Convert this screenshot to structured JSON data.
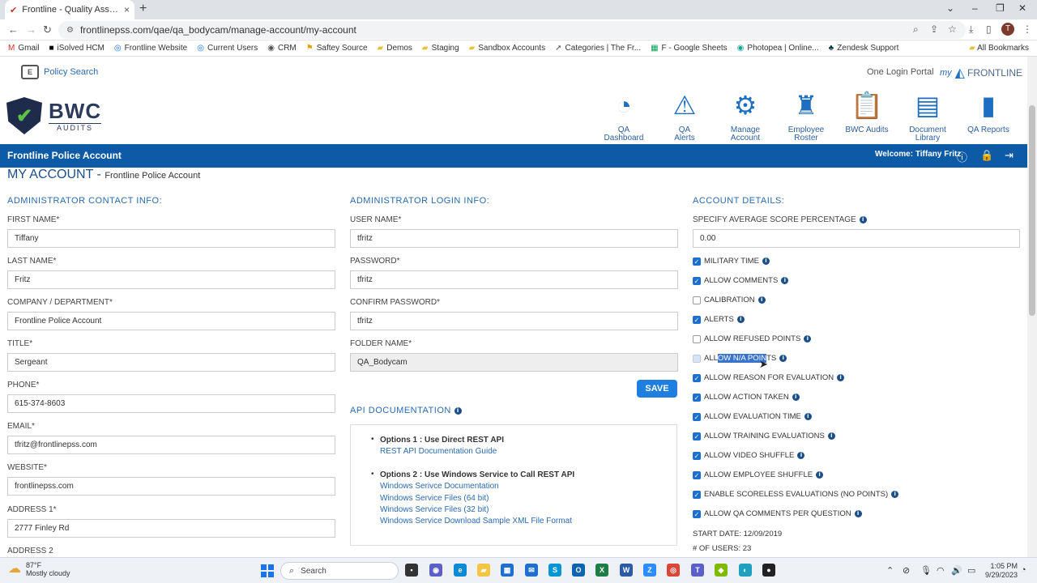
{
  "browser": {
    "tab_title": "Frontline - Quality Assurance E",
    "url": "frontlinepss.com/qae/qa_bodycam/manage-account/my-account",
    "avatar_letter": "T",
    "bookmarks": [
      "Gmail",
      "iSolved HCM",
      "Frontline Website",
      "Current Users",
      "CRM",
      "Saftey Source",
      "Demos",
      "Staging",
      "Sandbox Accounts",
      "Categories | The Fr...",
      "F - Google Sheets",
      "Photopea | Online...",
      "Zendesk Support"
    ],
    "all_bookmarks": "All Bookmarks"
  },
  "header": {
    "policy_search": "Policy Search",
    "one_login": "One Login Portal",
    "my_frontline_my": "my",
    "my_frontline_brand": "FRONTLINE",
    "logo_main": "BWC",
    "logo_sub": "AUDITS",
    "nav": [
      {
        "l1": "QA",
        "l2": "Dashboard"
      },
      {
        "l1": "QA",
        "l2": "Alerts"
      },
      {
        "l1": "Manage",
        "l2": "Account"
      },
      {
        "l1": "Employee",
        "l2": "Roster"
      },
      {
        "l1": "BWC Audits",
        "l2": ""
      },
      {
        "l1": "Document",
        "l2": "Library"
      },
      {
        "l1": "QA Reports",
        "l2": ""
      }
    ]
  },
  "bar": {
    "account": "Frontline Police Account",
    "welcome": "Welcome: Tiffany Fritz"
  },
  "page": {
    "title": "MY ACCOUNT",
    "title_sep": " - ",
    "subtitle": "Frontline Police Account"
  },
  "admin_contact": {
    "heading": "ADMINISTRATOR CONTACT INFO:",
    "first_name_label": "FIRST NAME*",
    "first_name": "Tiffany",
    "last_name_label": "LAST NAME*",
    "last_name": "Fritz",
    "company_label": "COMPANY / DEPARTMENT*",
    "company": "Frontline Police Account",
    "title_label": "TITLE*",
    "title": "Sergeant",
    "phone_label": "PHONE*",
    "phone": "615-374-8603",
    "email_label": "EMAIL*",
    "email": "tfritz@frontlinepss.com",
    "website_label": "WEBSITE*",
    "website": "frontlinepss.com",
    "address1_label": "ADDRESS 1*",
    "address1": "2777 Finley Rd",
    "address2_label": "ADDRESS 2"
  },
  "admin_login": {
    "heading": "ADMINISTRATOR LOGIN INFO:",
    "username_label": "USER NAME*",
    "username": "tfritz",
    "password_label": "PASSWORD*",
    "password": "tfritz",
    "confirm_label": "CONFIRM PASSWORD*",
    "confirm": "tfritz",
    "folder_label": "FOLDER NAME*",
    "folder": "QA_Bodycam",
    "save": "SAVE"
  },
  "api": {
    "heading": "API DOCUMENTATION",
    "opt1": "Options 1 : Use Direct REST API",
    "opt1_link": "REST API Documentation Guide",
    "opt2": "Options 2 : Use Windows Service to Call REST API",
    "opt2_links": [
      "Windows Serivce Documentation",
      "Windows Service Files (64 bit)",
      "Windows Service Files (32 bit)",
      "Windows Service Download Sample XML File Format"
    ]
  },
  "account_details": {
    "heading": "ACCOUNT DETAILS:",
    "avg_label": "SPECIFY AVERAGE SCORE PERCENTAGE",
    "avg_value": "0.00",
    "options": [
      {
        "label": "MILITARY TIME",
        "checked": true
      },
      {
        "label": "ALLOW COMMENTS",
        "checked": true
      },
      {
        "label": "CALIBRATION",
        "checked": false
      },
      {
        "label": "ALERTS",
        "checked": true
      },
      {
        "label": "ALLOW REFUSED POINTS",
        "checked": false
      },
      {
        "label_pre": "ALL",
        "label_sel": "OW N/A POIN",
        "label_post": "TS",
        "checked": false
      },
      {
        "label": "ALLOW REASON FOR EVALUATION",
        "checked": true
      },
      {
        "label": "ALLOW ACTION TAKEN",
        "checked": true
      },
      {
        "label": "ALLOW EVALUATION TIME",
        "checked": true
      },
      {
        "label": "ALLOW TRAINING EVALUATIONS",
        "checked": true
      },
      {
        "label": "ALLOW VIDEO SHUFFLE",
        "checked": true
      },
      {
        "label": "ALLOW EMPLOYEE SHUFFLE",
        "checked": true
      },
      {
        "label": "ENABLE SCORELESS EVALUATIONS (NO POINTS)",
        "checked": true
      },
      {
        "label": "ALLOW QA COMMENTS PER QUESTION",
        "checked": true
      }
    ],
    "start_date": "START DATE: 12/09/2019",
    "num_users": "# OF USERS: 23"
  },
  "taskbar": {
    "temp": "87°F",
    "weather": "Mostly cloudy",
    "search": "Search",
    "time": "1:05 PM",
    "date": "9/29/2023"
  }
}
